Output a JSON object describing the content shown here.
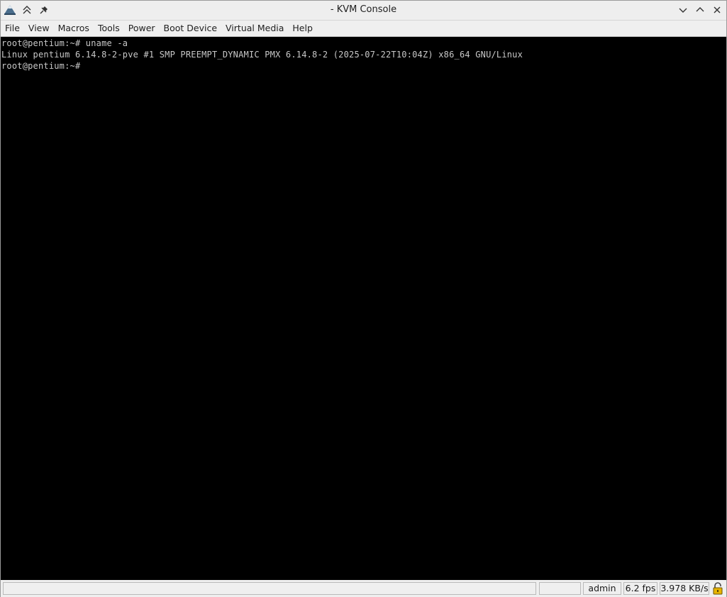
{
  "window": {
    "title": "- KVM Console",
    "icons": {
      "app": "app-logo-icon",
      "keep_above": "keep-above-icon",
      "pin": "pin-icon",
      "minimize": "minimize-icon",
      "maximize": "maximize-icon",
      "close": "close-icon"
    }
  },
  "menubar": {
    "items": [
      {
        "label": "File"
      },
      {
        "label": "View"
      },
      {
        "label": "Macros"
      },
      {
        "label": "Tools"
      },
      {
        "label": "Power"
      },
      {
        "label": "Boot Device"
      },
      {
        "label": "Virtual Media"
      },
      {
        "label": "Help"
      }
    ]
  },
  "console": {
    "lines": [
      "root@pentium:~# uname -a",
      "Linux pentium 6.14.8-2-pve #1 SMP PREEMPT_DYNAMIC PMX 6.14.8-2 (2025-07-22T10:04Z) x86_64 GNU/Linux",
      "root@pentium:~#"
    ],
    "background": "#000000",
    "foreground": "#c8c8c8"
  },
  "statusbar": {
    "message": "",
    "blank": "",
    "user": "admin",
    "fps": "6.2 fps",
    "bandwidth": "3.978 KB/s",
    "lock_icon": "unlocked-padlock-icon"
  }
}
